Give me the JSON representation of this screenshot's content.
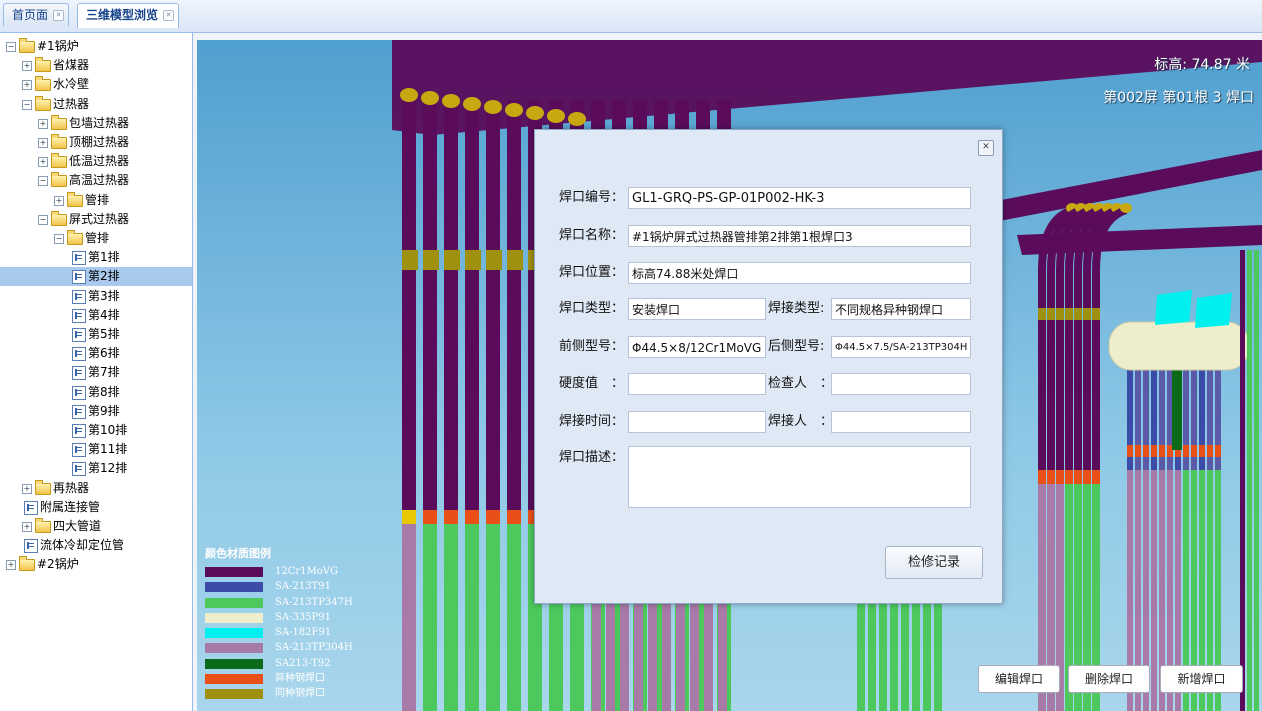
{
  "tabs": [
    {
      "label": "首页面",
      "active": false
    },
    {
      "label": "三维模型浏览",
      "active": true
    }
  ],
  "tree": {
    "nodes": [
      {
        "label": "#1锅炉",
        "depth": 0,
        "kind": "folder",
        "expanded": true
      },
      {
        "label": "省煤器",
        "depth": 1,
        "kind": "folder",
        "expanded": false
      },
      {
        "label": "水冷壁",
        "depth": 1,
        "kind": "folder",
        "expanded": false
      },
      {
        "label": "过热器",
        "depth": 1,
        "kind": "folder",
        "expanded": true
      },
      {
        "label": "包墙过热器",
        "depth": 2,
        "kind": "folder",
        "expanded": false
      },
      {
        "label": "顶棚过热器",
        "depth": 2,
        "kind": "folder",
        "expanded": false
      },
      {
        "label": "低温过热器",
        "depth": 2,
        "kind": "folder",
        "expanded": false
      },
      {
        "label": "高温过热器",
        "depth": 2,
        "kind": "folder",
        "expanded": true
      },
      {
        "label": "管排",
        "depth": 3,
        "kind": "folder",
        "expanded": false
      },
      {
        "label": "屏式过热器",
        "depth": 2,
        "kind": "folder",
        "expanded": true
      },
      {
        "label": "管排",
        "depth": 3,
        "kind": "folder",
        "expanded": true
      },
      {
        "label": "第1排",
        "depth": 4,
        "kind": "leaf"
      },
      {
        "label": "第2排",
        "depth": 4,
        "kind": "leaf",
        "selected": true
      },
      {
        "label": "第3排",
        "depth": 4,
        "kind": "leaf"
      },
      {
        "label": "第4排",
        "depth": 4,
        "kind": "leaf"
      },
      {
        "label": "第5排",
        "depth": 4,
        "kind": "leaf"
      },
      {
        "label": "第6排",
        "depth": 4,
        "kind": "leaf"
      },
      {
        "label": "第7排",
        "depth": 4,
        "kind": "leaf"
      },
      {
        "label": "第8排",
        "depth": 4,
        "kind": "leaf"
      },
      {
        "label": "第9排",
        "depth": 4,
        "kind": "leaf"
      },
      {
        "label": "第10排",
        "depth": 4,
        "kind": "leaf"
      },
      {
        "label": "第11排",
        "depth": 4,
        "kind": "leaf"
      },
      {
        "label": "第12排",
        "depth": 4,
        "kind": "leaf"
      },
      {
        "label": "再热器",
        "depth": 1,
        "kind": "folder",
        "expanded": false
      },
      {
        "label": "附属连接管",
        "depth": 1,
        "kind": "leaf"
      },
      {
        "label": "四大管道",
        "depth": 1,
        "kind": "folder",
        "expanded": false
      },
      {
        "label": "流体冷却定位管",
        "depth": 1,
        "kind": "leaf"
      },
      {
        "label": "#2锅炉",
        "depth": 0,
        "kind": "folder",
        "expanded": false
      }
    ]
  },
  "viewport": {
    "elevation_text": "标高: 74.87 米",
    "position_text": "第002屏 第01根 3 焊口"
  },
  "legend": {
    "title": "颜色材质图例",
    "items": [
      {
        "label": "12Cr1MoVG",
        "color": "#5a0c5a"
      },
      {
        "label": "SA-213T91",
        "color": "#3c4aa8"
      },
      {
        "label": "SA-213TP347H",
        "color": "#4cc85c"
      },
      {
        "label": "SA-335P91",
        "color": "#eeeecc"
      },
      {
        "label": "SA-182F91",
        "color": "#00f0f0"
      },
      {
        "label": "SA-213TP304H",
        "color": "#a77aa8"
      },
      {
        "label": "SA213-T92",
        "color": "#0a6a1a"
      },
      {
        "label": "异种钢焊口",
        "color": "#e85018"
      },
      {
        "label": "同种钢焊口",
        "color": "#a09010"
      }
    ]
  },
  "buttons": {
    "edit": "编辑焊口",
    "delete": "删除焊口",
    "add": "新增焊口"
  },
  "dialog": {
    "close_icon": "close-icon",
    "weld_no_label": "焊口编号：",
    "weld_no": "GL1-GRQ-PS-GP-01P002-HK-3",
    "weld_name_label": "焊口名称：",
    "weld_name": "#1锅炉屏式过热器管排第2排第1根焊口3",
    "weld_pos_label": "焊口位置：",
    "weld_pos": "标高74.88米处焊口",
    "weld_type_label": "焊口类型：",
    "weld_type": "安装焊口",
    "join_type_label": "焊接类型:",
    "join_type": "不同规格异种钢焊口",
    "front_model_label": "前侧型号：",
    "front_model": "Φ44.5×8/12Cr1MoVG",
    "rear_model_label": "后侧型号:",
    "rear_model": "Φ44.5×7.5/SA-213TP304H",
    "hardness_label": "硬度值　：",
    "hardness": "",
    "inspector_label": "检查人　：",
    "inspector": "",
    "weld_time_label": "焊接时间：",
    "weld_time": "",
    "welder_label": "焊接人　：",
    "welder": "",
    "desc_label": "焊口描述：",
    "desc": "",
    "repair_button": "检修记录"
  }
}
